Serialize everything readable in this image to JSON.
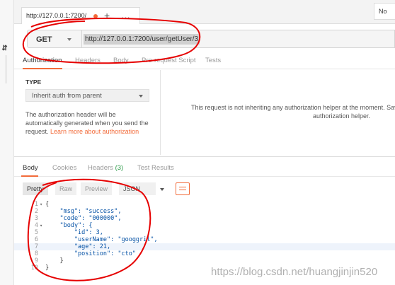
{
  "tabbar": {
    "active_tab_label": "http://127.0.0.1:7200/",
    "add_tab_glyph": "+",
    "more_tabs_glyph": "…",
    "env_label": "No"
  },
  "sidebar": {
    "toggle_glyph": "⇆"
  },
  "request": {
    "method": "GET",
    "url": "http://127.0.0.1:7200/user/getUser/3"
  },
  "request_tabs": [
    "Authorization",
    "Headers",
    "Body",
    "Pre-request Script",
    "Tests"
  ],
  "auth": {
    "type_label": "TYPE",
    "type_value": "Inherit auth from parent",
    "description_parts": [
      "The authorization header will be automatically generated when you send the request. "
    ],
    "learn_more_link": "Learn more about authorization",
    "info_line1": "This request is not inheriting any authorization helper at the moment. Save",
    "info_line2": "authorization helper."
  },
  "response_tabs": {
    "body": "Body",
    "cookies": "Cookies",
    "headers": "Headers",
    "headers_count": "(3)",
    "test_results": "Test Results"
  },
  "view_modes": {
    "pretty": "Pretty",
    "raw": "Raw",
    "preview": "Preview",
    "format": "JSON"
  },
  "response_body": {
    "line_numbers": [
      "1",
      "2",
      "3",
      "4",
      "5",
      "6",
      "7",
      "8",
      "9",
      "10"
    ],
    "lines": [
      "{",
      "    \"msg\": \"success\",",
      "    \"code\": \"000000\",",
      "    \"body\": {",
      "        \"id\": 3,",
      "        \"userName\": \"googgril\",",
      "        \"age\": 21,",
      "        \"position\": \"cto\"",
      "    }",
      "}"
    ]
  },
  "watermark": "https://blog.csdn.net/huangjinjin520",
  "colors": {
    "accent": "#f26b3a",
    "annotation_red": "#e60000",
    "headers_count": "#2e9c4a"
  }
}
